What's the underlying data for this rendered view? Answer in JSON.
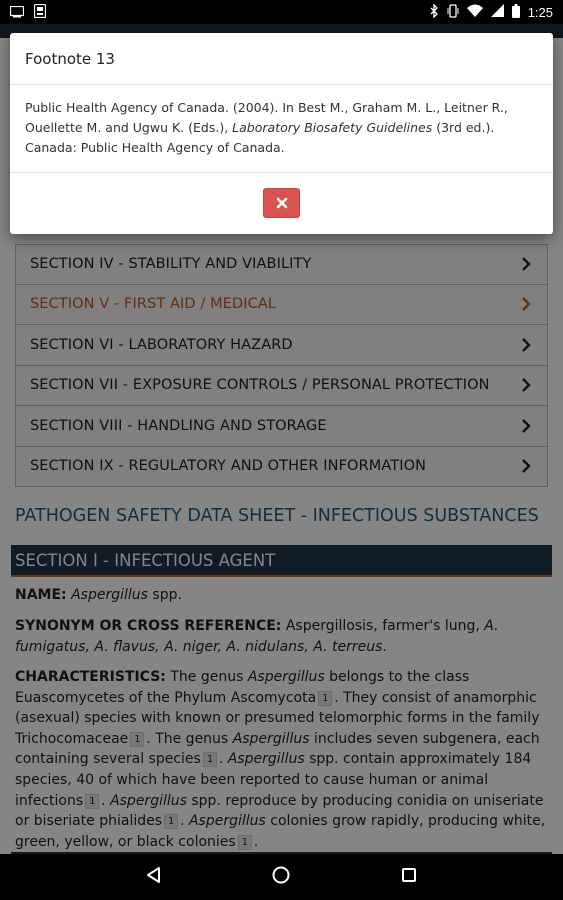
{
  "status_bar": {
    "time": "1:25",
    "left_icons": [
      "photo-icon",
      "sim-card-icon"
    ],
    "right_icons": [
      "bluetooth-icon",
      "vibrate-icon",
      "wifi-icon",
      "signal-icon",
      "battery-icon"
    ]
  },
  "modal": {
    "title": "Footnote 13",
    "body_prefix": "Public Health Agency of Canada. (2004). In Best M., Graham M. L., Leitner R., Ouellette M. and Ugwu K. (Eds.), ",
    "body_italic": "Laboratory Biosafety Guidelines",
    "body_suffix": " (3rd ed.). Canada: Public Health Agency of Canada.",
    "close_icon": "close-icon",
    "close_color": "#d9534f"
  },
  "menu": {
    "items": [
      {
        "label": "SECTION IV - STABILITY AND VIABILITY"
      },
      {
        "label": "SECTION V - FIRST AID / MEDICAL"
      },
      {
        "label": "SECTION VI - LABORATORY HAZARD"
      },
      {
        "label": "SECTION VII - EXPOSURE CONTROLS / PERSONAL PROTECTION"
      },
      {
        "label": "SECTION VIII - HANDLING AND STORAGE"
      },
      {
        "label": "SECTION IX - REGULATORY AND OTHER INFORMATION"
      }
    ],
    "active_color": "#c4541f"
  },
  "page": {
    "title": "PATHOGEN SAFETY DATA SHEET - INFECTIOUS SUBSTANCES",
    "section_title": "SECTION I - INFECTIOUS AGENT",
    "section_bar_color": "#1f3748",
    "accent_color": "#d8651f"
  },
  "content": {
    "name_label": "NAME:",
    "name_value": "Aspergillus",
    "name_suffix": " spp.",
    "synonym_label": "SYNONYM OR CROSS REFERENCE:",
    "synonym_text1": " Aspergillosis, farmer's lung, ",
    "synonym_italic": "A. fumigatus, A. flavus, A. niger, A. nidulans, A. terreus",
    "synonym_text2": ".",
    "char_label": "CHARACTERISTICS:",
    "char_t1": " The genus ",
    "char_i1": "Aspergillus",
    "char_t2": " belongs to the class Euascomycetes of the Phylum Ascomycota",
    "char_t3": ". They consist of anamorphic (asexual) species with known or presumed telomorphic forms in the family Trichocomaceae",
    "char_t4": ". The genus ",
    "char_i2": "Aspergillus",
    "char_t5": " includes seven subgenera, each containing several species",
    "char_t6": ". ",
    "char_i3": "Aspergillus",
    "char_t7": " spp. contain approximately 184 species, 40 of which have been reported to cause human or animal infections",
    "char_t8": ". ",
    "char_i4": "Aspergillus",
    "char_t9": " spp. reproduce by producing conidia on uniseriate or biseriate phialides",
    "char_t10": ". ",
    "char_i5": "Aspergillus",
    "char_t11": " colonies grow rapidly, producing white, green, yellow, or black colonies",
    "char_t12": ".",
    "ref": "1"
  },
  "nav_bar": {
    "buttons": [
      "back-icon",
      "home-icon",
      "recents-icon"
    ]
  }
}
